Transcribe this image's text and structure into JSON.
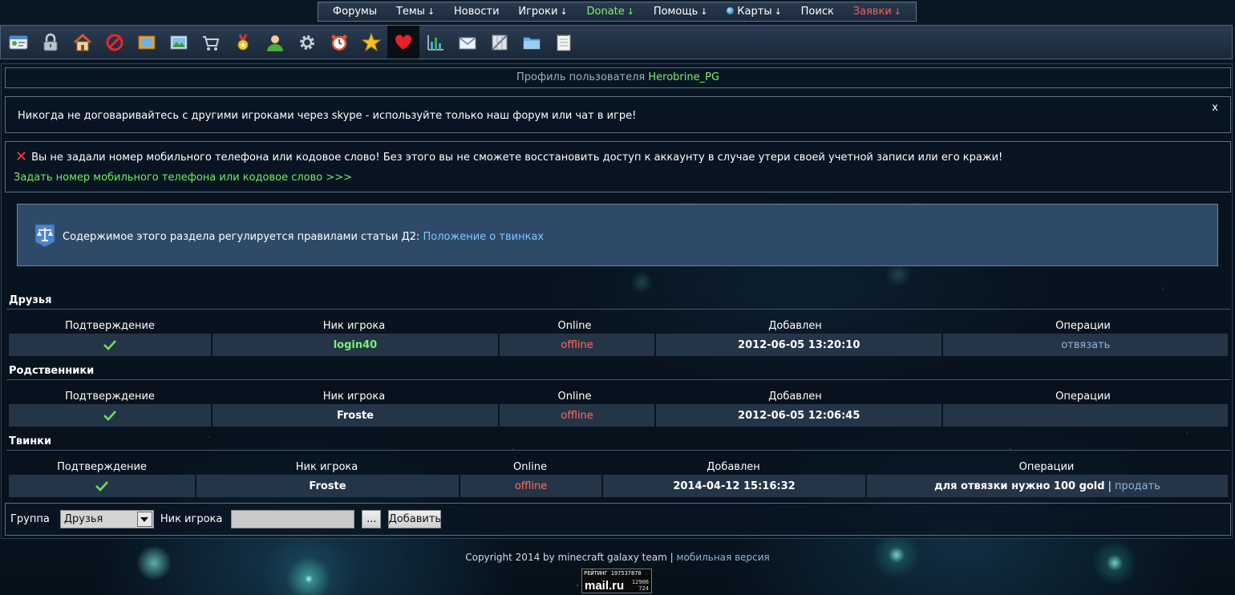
{
  "colors": {
    "accent_green": "#7cf06e",
    "offline_red": "#ff6b5a",
    "link_blue": "#7ec7ff",
    "request_red": "#ff5a5a"
  },
  "nav": {
    "forums": "Форумы",
    "topics": "Темы",
    "news": "Новости",
    "players": "Игроки",
    "donate": "Donate",
    "help": "Помощь",
    "maps": "Карты",
    "search": "Поиск",
    "requests": "Заявки",
    "arrow": "↓"
  },
  "toolbar": {
    "icons": [
      "id-card-icon",
      "lock-icon",
      "home-icon",
      "ban-icon",
      "picture-frame-icon",
      "landscape-icon",
      "cart-icon",
      "medal-icon",
      "user-icon",
      "gear-icon",
      "alarm-clock-icon",
      "star-icon",
      "heart-icon",
      "bar-chart-icon",
      "envelope-icon",
      "grid-icon",
      "folder-icon",
      "notepad-icon"
    ],
    "active": "heart-icon"
  },
  "profile": {
    "prefix": "Профиль пользователя",
    "username": "Herobrine_PG"
  },
  "notice": {
    "text": "Никогда не договаривайтесь с другими игроками через skype - используйте только наш форум или чат в игре!",
    "close": "x"
  },
  "warning": {
    "text": "Вы не задали номер мобильного телефона или кодовое слово! Без этого вы не сможете восстановить доступ к аккаунту в случае утери своей учетной записи или его кражи!",
    "link": "Задать номер мобильного телефона или кодовое слово >>>"
  },
  "info": {
    "text": "Содержимое этого раздела регулируется правилами статьи Д2:",
    "link": "Положение о твинках"
  },
  "headers": {
    "confirm": "Подтверждение",
    "nick": "Ник игрока",
    "online": "Online",
    "added": "Добавлен",
    "ops": "Операции"
  },
  "friends": {
    "title": "Друзья",
    "rows": [
      {
        "nick": "login40",
        "online": "offline",
        "added": "2012-06-05 13:20:10",
        "op": "отвязать"
      }
    ]
  },
  "relatives": {
    "title": "Родственники",
    "rows": [
      {
        "nick": "Froste",
        "online": "offline",
        "added": "2012-06-05 12:06:45",
        "op": ""
      }
    ]
  },
  "twinks": {
    "title": "Твинки",
    "rows": [
      {
        "nick": "Froste",
        "online": "offline",
        "added": "2014-04-12 15:16:32",
        "op_text": "для отвязки нужно 100 gold",
        "op_sep": "|",
        "op_link": "продать"
      }
    ]
  },
  "form": {
    "group_label": "Группа",
    "group_value": "Друзья",
    "nick_label": "Ник игрока",
    "nick_value": "",
    "browse_label": "...",
    "add_label": "Добавить"
  },
  "footer": {
    "copyright": "Copyright 2014 by minecraft galaxy team",
    "sep": "|",
    "mobile": "мобильная версия"
  },
  "counter": {
    "rating": "РЕЙТИНГ 197537870",
    "brand": "mail.ru",
    "num1": "12906",
    "num2": "724"
  }
}
